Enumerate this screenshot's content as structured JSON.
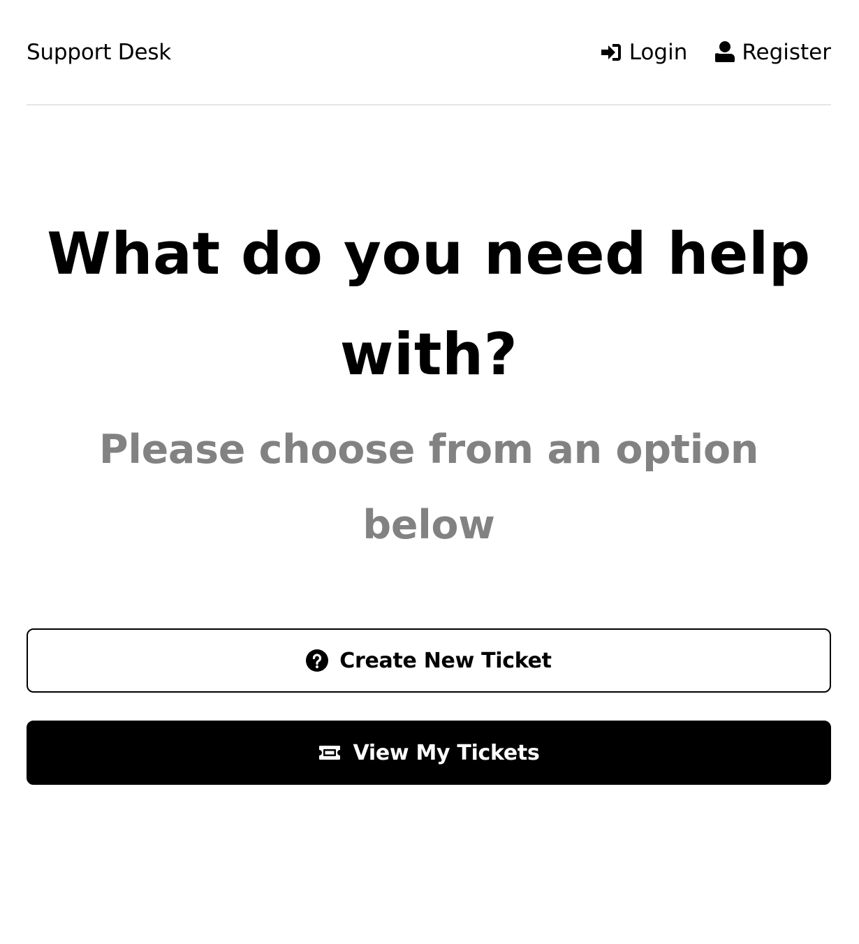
{
  "header": {
    "brand": "Support Desk",
    "nav": [
      {
        "label": "Login",
        "icon": "sign-in-icon"
      },
      {
        "label": "Register",
        "icon": "user-icon"
      }
    ]
  },
  "hero": {
    "heading": "What do you need help with?",
    "subheading": "Please choose from an option below"
  },
  "actions": {
    "create_ticket": {
      "label": "Create New Ticket",
      "icon": "question-circle-icon"
    },
    "view_tickets": {
      "label": "View My Tickets",
      "icon": "ticket-icon"
    }
  },
  "colors": {
    "text": "#000000",
    "muted": "#828282",
    "divider": "#e6e6e6",
    "solid_button_bg": "#000000"
  }
}
